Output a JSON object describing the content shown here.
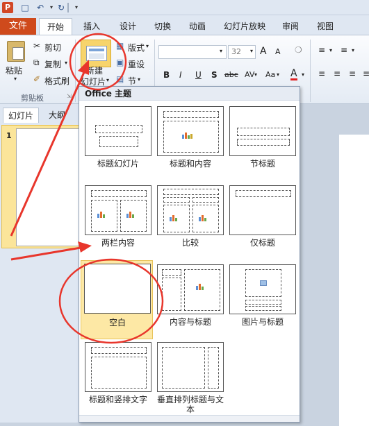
{
  "qat": {
    "app_logo": "P",
    "save_icon": "💾",
    "undo_icon": "↶",
    "redo_icon": "↻",
    "dropdown_glyph": "▾"
  },
  "tabs": {
    "file": "文件",
    "items": [
      "开始",
      "插入",
      "设计",
      "切换",
      "动画",
      "幻灯片放映",
      "审阅",
      "视图"
    ]
  },
  "ribbon": {
    "paste": "粘贴",
    "cut": "剪切",
    "copy": "复制",
    "format_painter": "格式刷",
    "clipboard_group": "剪贴板",
    "new_slide_line1": "新建",
    "new_slide_line2": "幻灯片",
    "layout": "版式",
    "reset": "重设",
    "section": "节",
    "font_size": "32",
    "bold": "B",
    "italic": "I",
    "underline": "U",
    "strike": "S",
    "abc": "abc",
    "av": "AV",
    "aa": "Aa",
    "a_grow": "A",
    "a_shrink": "A",
    "font_color": "A"
  },
  "left_panel": {
    "tab_slides": "幻灯片",
    "tab_outline": "大纲",
    "slide_number": "1"
  },
  "gallery": {
    "header": "Office 主题",
    "layouts": [
      "标题幻灯片",
      "标题和内容",
      "节标题",
      "两栏内容",
      "比较",
      "仅标题",
      "空白",
      "内容与标题",
      "图片与标题",
      "标题和竖排文字",
      "垂直排列标题与文本"
    ]
  },
  "colors": {
    "file_tab": "#cf4a1c",
    "annotation_red": "#e8362c",
    "selected_layout": "#fde8a5"
  }
}
